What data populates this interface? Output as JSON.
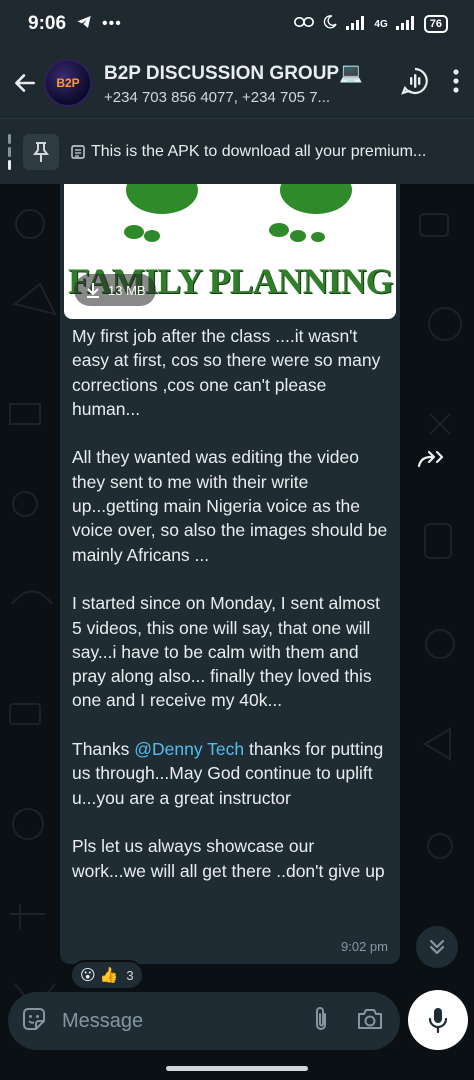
{
  "status_bar": {
    "time": "9:06",
    "network": "4G",
    "battery": "76"
  },
  "header": {
    "avatar_text": "B2P",
    "title": "B2P DISCUSSION GROUP💻",
    "members": "+234 703 856 4077, +234 705 7..."
  },
  "pinned": {
    "text": "This is the APK to download all your premium..."
  },
  "message": {
    "media_caption": "FAMILY PLANNING",
    "media_size": "13 MB",
    "p1": "My first job after the class ....it wasn't easy at first, cos so there were so many corrections ,cos one can't please human...",
    "p2": "All they wanted was editing the video they sent to me with their write up...getting main Nigeria voice as the voice over, so also the images should be mainly Africans ...",
    "p3": "I started since on Monday, I sent almost 5 videos, this one will say, that one will say...i have to be calm with them and pray along also... finally they loved this one and I receive my 40k...",
    "p4_before": "Thanks ",
    "p4_mention": "@Denny Tech",
    "p4_after": " thanks for putting us through...May God continue to uplift u...you are a great instructor",
    "p5": "Pls let us always showcase our work...we will all get there ..don't give up",
    "time": "9:02 pm",
    "reactions": {
      "emojis": [
        "😮",
        "👍"
      ],
      "count": "3"
    }
  },
  "composer": {
    "placeholder": "Message"
  },
  "colors": {
    "header_bg": "#1f2a30",
    "bubble_bg": "#1f2c33",
    "mention": "#53bdeb",
    "chat_bg": "#0b1014"
  }
}
